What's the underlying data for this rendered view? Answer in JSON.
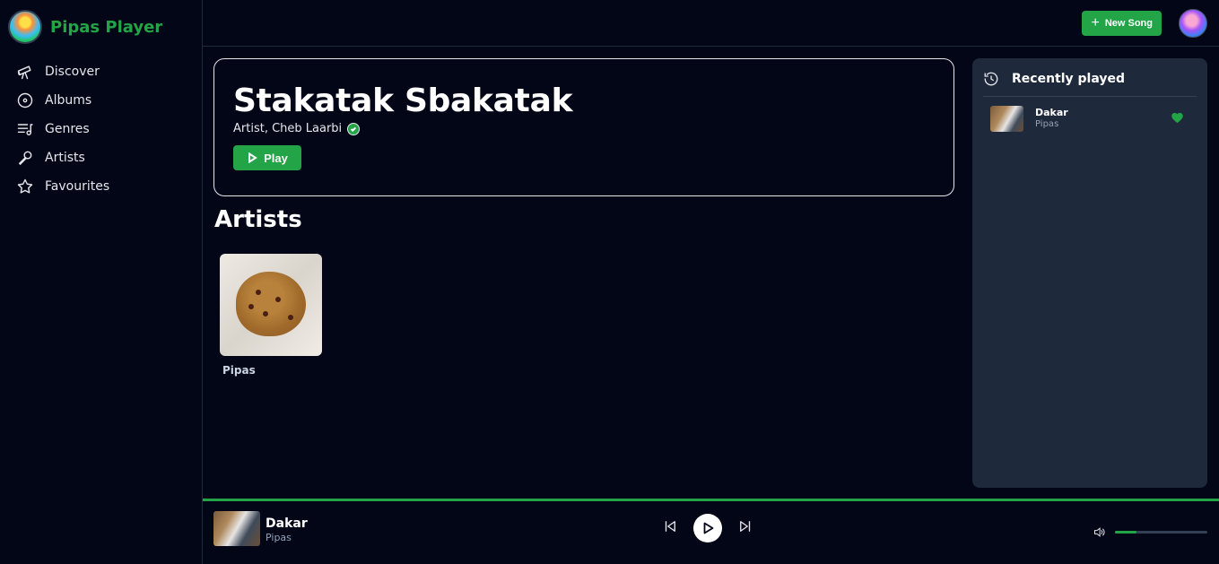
{
  "app": {
    "name": "Pipas Player",
    "accent_color": "#22a447",
    "background_color": "#020617",
    "panel_color": "#1e293b"
  },
  "sidebar": {
    "items": [
      {
        "label": "Discover",
        "icon": "telescope-icon"
      },
      {
        "label": "Albums",
        "icon": "disc-icon"
      },
      {
        "label": "Genres",
        "icon": "playlist-icon"
      },
      {
        "label": "Artists",
        "icon": "microphone-icon"
      },
      {
        "label": "Favourites",
        "icon": "star-icon"
      }
    ]
  },
  "topbar": {
    "new_song_label": "New Song",
    "avatar_icon": "user-avatar"
  },
  "hero": {
    "title": "Stakatak Sbakatak",
    "subtitle": "Artist, Cheb Laarbi",
    "verified_icon": "verified-check-icon",
    "play_label": "Play"
  },
  "artists_section": {
    "title": "Artists",
    "cards": [
      {
        "name": "Pipas",
        "image": "cookie-photo"
      }
    ]
  },
  "recently_played": {
    "title": "Recently played",
    "icon": "history-icon",
    "items": [
      {
        "title": "Dakar",
        "artist": "Pipas",
        "favourite": true
      }
    ]
  },
  "player": {
    "track_title": "Dakar",
    "track_artist": "Pipas",
    "volume_level": 0.23
  }
}
